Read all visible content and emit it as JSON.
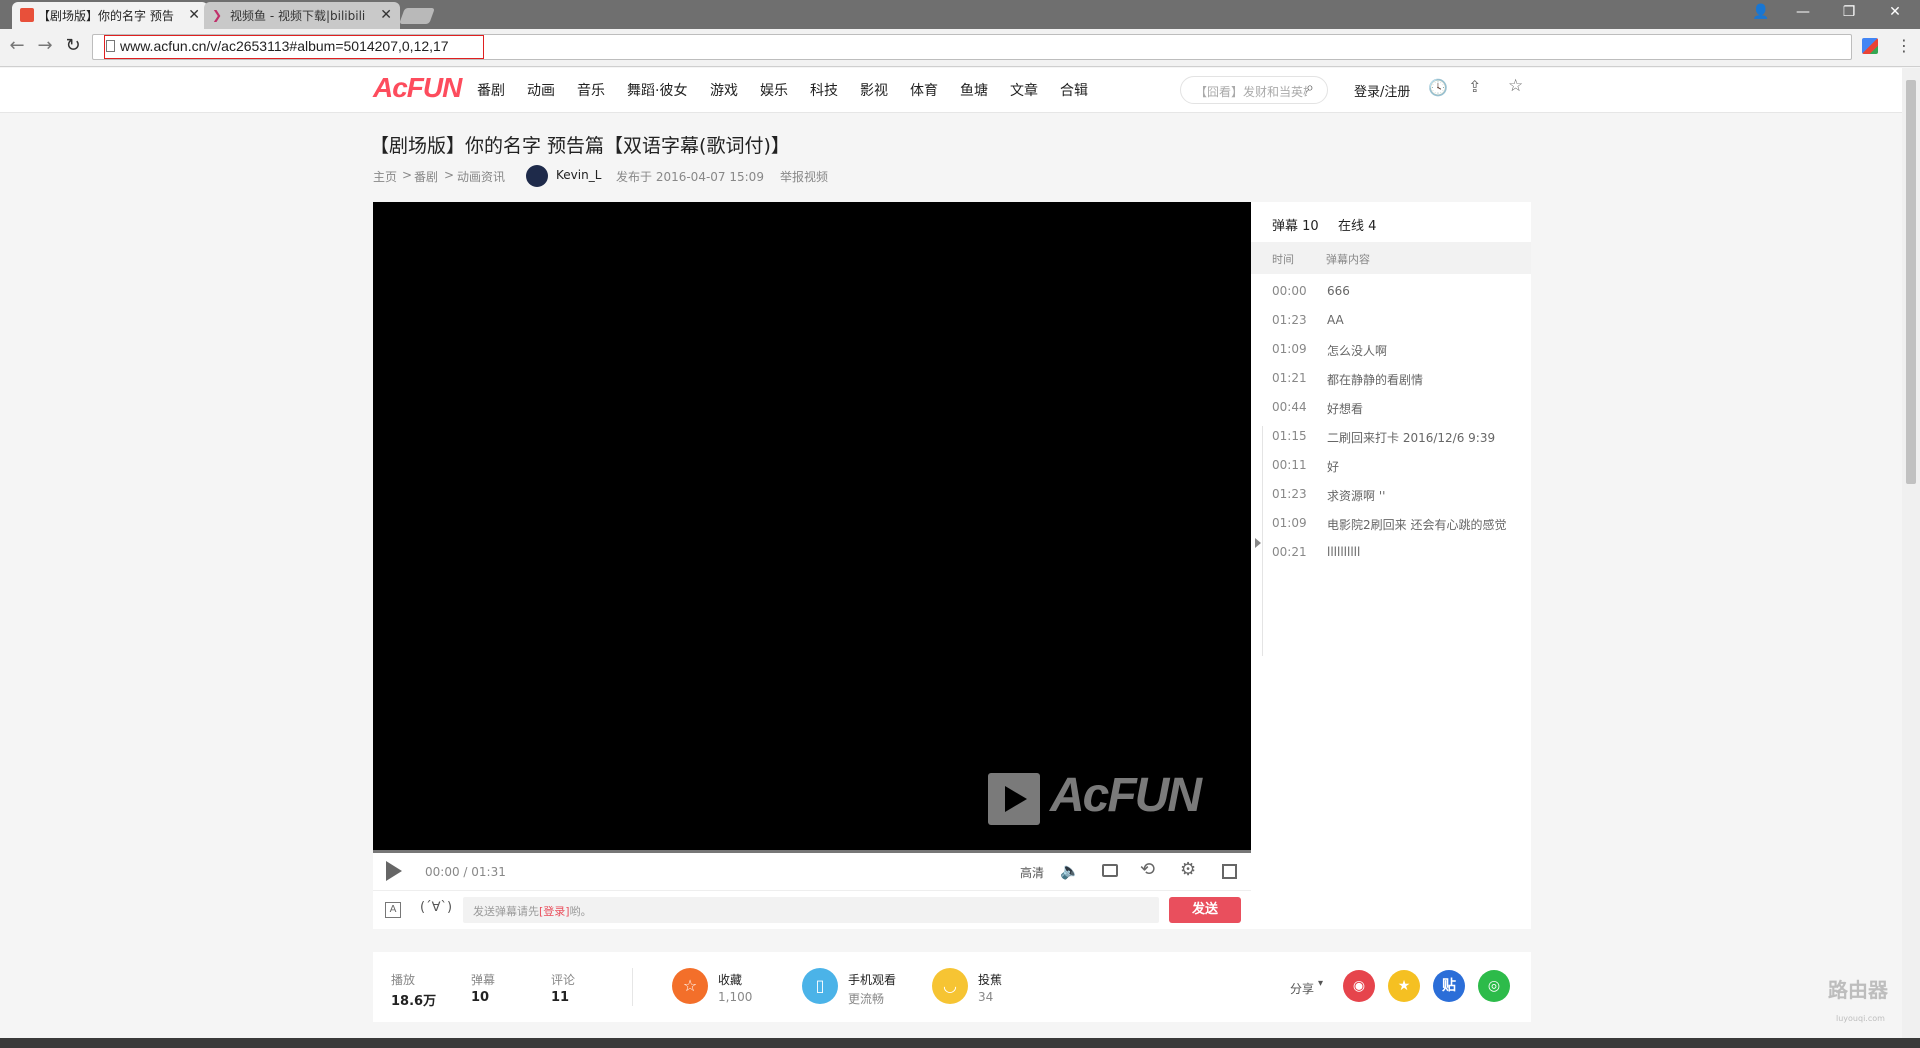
{
  "browser": {
    "tabs": [
      {
        "title": "【剧场版】你的名字 预告"
      },
      {
        "title": "视频鱼 - 视频下载|bilibili"
      }
    ],
    "url": "www.acfun.cn/v/ac2653113#album=5014207,0,12,17"
  },
  "site": {
    "logo": "AcFUN",
    "nav": [
      "番剧",
      "动画",
      "音乐",
      "舞蹈·彼女",
      "游戏",
      "娱乐",
      "科技",
      "影视",
      "体育",
      "鱼塘",
      "文章",
      "合辑"
    ],
    "search_placeholder": "【囧看】发财和当英雄",
    "login": "登录/注册"
  },
  "page": {
    "title": "【剧场版】你的名字  预告篇【双语字幕(歌词付)】",
    "breadcrumb": [
      "主页",
      "番剧",
      "动画资讯"
    ],
    "uploader": "Kevin_L",
    "published": "发布于  2016-04-07  15:09",
    "report": "举报视频"
  },
  "player": {
    "watermark": "AcFUN",
    "time": "00:00 / 01:31",
    "quality": "高清",
    "emoticon": "(´∀`)",
    "danmaku_placeholder_pre": "发送弹幕请先",
    "danmaku_placeholder_link": "[登录]",
    "danmaku_placeholder_post": "哟。",
    "send": "发送"
  },
  "danmaku_panel": {
    "count_label": "弹幕 10",
    "online_label": "在线 4",
    "col_time": "时间",
    "col_content": "弹幕内容",
    "rows": [
      {
        "time": "00:00",
        "text": "666"
      },
      {
        "time": "01:23",
        "text": "AA"
      },
      {
        "time": "01:09",
        "text": "怎么没人啊"
      },
      {
        "time": "01:21",
        "text": "都在静静的看剧情"
      },
      {
        "time": "00:44",
        "text": "好想看"
      },
      {
        "time": "01:15",
        "text": "二刷回来打卡 2016/12/6 9:39"
      },
      {
        "time": "00:11",
        "text": "好"
      },
      {
        "time": "01:23",
        "text": "求资源啊  ''"
      },
      {
        "time": "01:09",
        "text": "电影院2刷回来 还会有心跳的感觉"
      },
      {
        "time": "00:21",
        "text": "llllllllll"
      }
    ]
  },
  "stats": {
    "play_label": "播放",
    "play_value": "18.6万",
    "danmaku_label": "弹幕",
    "danmaku_value": "10",
    "comment_label": "评论",
    "comment_value": "11",
    "fav_label": "收藏",
    "fav_value": "1,100",
    "mobile_label": "手机观看",
    "mobile_sub": "更流畅",
    "banana_label": "投蕉",
    "banana_value": "34",
    "share_label": "分享",
    "share_tieba": "贴"
  },
  "watermark_corner": "路由器",
  "watermark_corner_sub": "luyouqi.com",
  "colors": {
    "accent": "#fd4c5d",
    "send": "#e94f5d",
    "fav": "#f36f2a",
    "mobile": "#4bb3e8",
    "banana": "#f6c433"
  }
}
